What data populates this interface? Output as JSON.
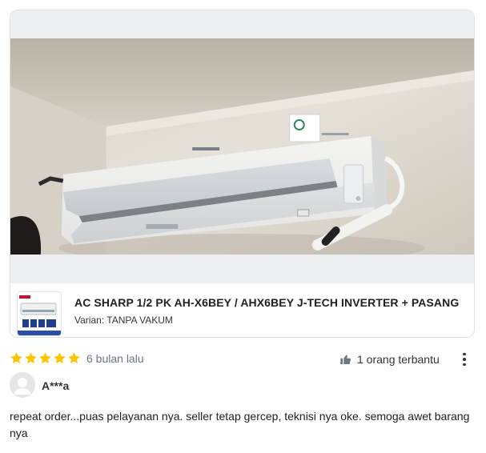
{
  "review": {
    "product": {
      "name": "AC SHARP 1/2 PK AH-X6BEY / AHX6BEY J-TECH INVERTER + PASANG",
      "variant": "Varian: TANPA VAKUM",
      "brand_on_unit": "SHARP",
      "badge_on_unit": "J-TECH INVERTER"
    },
    "rating": {
      "stars": 5,
      "max": 5,
      "color": "#ffc400"
    },
    "time_ago": "6 bulan lalu",
    "helpful_text": "1 orang terbantu",
    "user": {
      "name": "A***a"
    },
    "text": "repeat order...puas pelayanan nya. seller tetap gercep, teknisi nya oke. semoga awet barang nya"
  },
  "icons": {
    "star": "star-icon",
    "helpful": "thumbs-up-icon",
    "menu": "kebab-menu-icon",
    "avatar": "user-avatar-icon"
  }
}
